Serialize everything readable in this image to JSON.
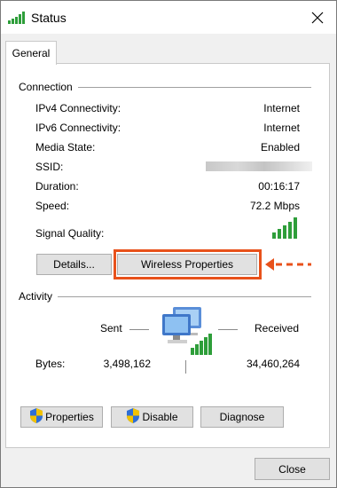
{
  "window": {
    "title": "Status"
  },
  "tabs": [
    {
      "label": "General"
    }
  ],
  "connection": {
    "heading": "Connection",
    "rows": [
      {
        "label": "IPv4 Connectivity:",
        "value": "Internet"
      },
      {
        "label": "IPv6 Connectivity:",
        "value": "Internet"
      },
      {
        "label": "Media State:",
        "value": "Enabled"
      },
      {
        "label": "SSID:",
        "value": ""
      },
      {
        "label": "Duration:",
        "value": "00:16:17"
      },
      {
        "label": "Speed:",
        "value": "72.2 Mbps"
      },
      {
        "label": "Signal Quality:",
        "value": ""
      }
    ],
    "signal_bars": 5,
    "details_label": "Details...",
    "wireless_label": "Wireless Properties"
  },
  "activity": {
    "heading": "Activity",
    "sent_label": "Sent",
    "received_label": "Received",
    "bytes_label": "Bytes:",
    "bytes_sent": "3,498,162",
    "bytes_received": "34,460,264",
    "properties_label": "Properties",
    "disable_label": "Disable",
    "diagnose_label": "Diagnose"
  },
  "footer": {
    "close_label": "Close"
  },
  "colors": {
    "highlight": "#e8511b",
    "signal": "#2e9e3a",
    "shield_blue": "#2f6fd6",
    "shield_yellow": "#f2c200"
  },
  "icons": [
    "wifi-signal-icon",
    "close-icon",
    "uac-shield-icon",
    "network-computers-icon",
    "arrow-left-icon"
  ]
}
